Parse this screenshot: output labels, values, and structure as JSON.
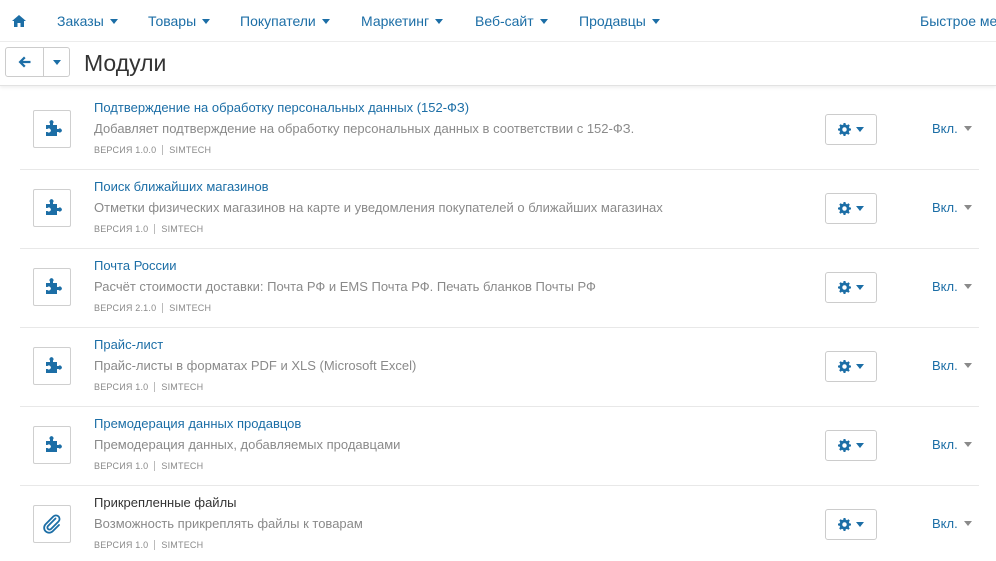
{
  "colors": {
    "accent": "#1c6ea6",
    "muted_text": "#8a8a8a",
    "border": "#cccccc"
  },
  "topnav": {
    "home_icon": "home-icon",
    "items": [
      {
        "label": "Заказы"
      },
      {
        "label": "Товары"
      },
      {
        "label": "Покупатели"
      },
      {
        "label": "Маркетинг"
      },
      {
        "label": "Веб-сайт"
      },
      {
        "label": "Продавцы"
      }
    ],
    "quick_menu": "Быстрое меню"
  },
  "titlebar": {
    "back_icon": "arrow-left-icon",
    "title": "Модули"
  },
  "modules": [
    {
      "icon": "puzzle-icon",
      "name": "Подтверждение на обработку персональных данных (152-ФЗ)",
      "description": "Добавляет подтверждение на обработку персональных данных в соответствии с 152-ФЗ.",
      "version": "ВЕРСИЯ 1.0.0",
      "vendor": "SIMTECH",
      "status": "Вкл."
    },
    {
      "icon": "puzzle-icon",
      "name": "Поиск ближайших магазинов",
      "description": "Отметки физических магазинов на карте и уведомления покупателей о ближайших магазинах",
      "version": "ВЕРСИЯ 1.0",
      "vendor": "SIMTECH",
      "status": "Вкл."
    },
    {
      "icon": "puzzle-icon",
      "name": "Почта России",
      "description": "Расчёт стоимости доставки: Почта РФ и EMS Почта РФ. Печать бланков Почты РФ",
      "version": "ВЕРСИЯ 2.1.0",
      "vendor": "SIMTECH",
      "status": "Вкл."
    },
    {
      "icon": "puzzle-icon",
      "name": "Прайс-лист",
      "description": "Прайс-листы в форматах PDF и XLS (Microsoft Excel)",
      "version": "ВЕРСИЯ 1.0",
      "vendor": "SIMTECH",
      "status": "Вкл."
    },
    {
      "icon": "puzzle-icon",
      "name": "Премодерация данных продавцов",
      "description": "Премодерация данных, добавляемых продавцами",
      "version": "ВЕРСИЯ 1.0",
      "vendor": "SIMTECH",
      "status": "Вкл."
    },
    {
      "icon": "paperclip-icon",
      "name": "Прикрепленные файлы",
      "description": "Возможность прикреплять файлы к товарам",
      "version": "ВЕРСИЯ 1.0",
      "vendor": "SIMTECH",
      "status": "Вкл."
    }
  ]
}
